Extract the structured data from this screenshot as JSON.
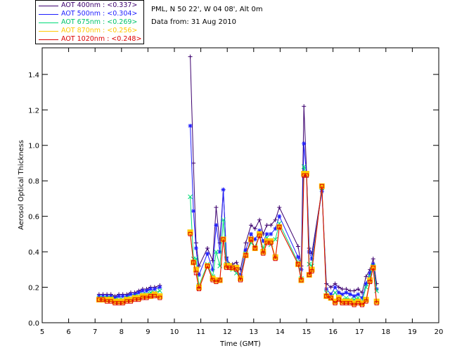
{
  "info": {
    "location": "PML, N 50 22', W 04 08', Alt 0m",
    "date_line": "Data from: 31 Aug 2010"
  },
  "chart_data": {
    "type": "line",
    "xlabel": "Time (GMT)",
    "ylabel": "Aerosol Optical Thickness",
    "xlim": [
      5,
      20
    ],
    "ylim": [
      0,
      1.55
    ],
    "x_ticks": [
      "5",
      "6",
      "7",
      "8",
      "9",
      "10",
      "11",
      "12",
      "13",
      "14",
      "15",
      "16",
      "17",
      "18",
      "19",
      "20"
    ],
    "y_ticks": [
      "0.0",
      "0.2",
      "0.4",
      "0.6",
      "0.8",
      "1.0",
      "1.2",
      "1.4"
    ],
    "legend_placement": "top-left outside plot",
    "series": [
      {
        "name": "AOT  400nm : <0.337>",
        "color": "#3c006e",
        "marker": "plus",
        "x": [
          7.15,
          7.3,
          7.45,
          7.6,
          7.75,
          7.9,
          8.05,
          8.2,
          8.35,
          8.5,
          8.65,
          8.8,
          8.95,
          9.1,
          9.25,
          9.45,
          10.6,
          10.72,
          10.82,
          10.93,
          11.25,
          11.45,
          11.58,
          11.72,
          11.85,
          11.97,
          12.08,
          12.2,
          12.35,
          12.5,
          12.7,
          12.9,
          13.05,
          13.22,
          13.36,
          13.5,
          13.65,
          13.82,
          13.97,
          14.68,
          14.8,
          14.9,
          15.0,
          15.1,
          15.2,
          15.58,
          15.75,
          15.92,
          16.08,
          16.22,
          16.35,
          16.5,
          16.65,
          16.8,
          16.95,
          17.1,
          17.25,
          17.4,
          17.52,
          17.65
        ],
        "y": [
          0.16,
          0.16,
          0.16,
          0.16,
          0.15,
          0.16,
          0.16,
          0.16,
          0.17,
          0.17,
          0.18,
          0.19,
          0.19,
          0.2,
          0.2,
          0.21,
          1.5,
          0.9,
          0.45,
          0.32,
          0.42,
          0.35,
          0.65,
          0.45,
          0.75,
          0.37,
          0.33,
          0.33,
          0.34,
          0.3,
          0.45,
          0.55,
          0.53,
          0.58,
          0.5,
          0.55,
          0.55,
          0.58,
          0.65,
          0.43,
          0.32,
          1.22,
          0.85,
          0.42,
          0.39,
          0.75,
          0.22,
          0.2,
          0.22,
          0.2,
          0.19,
          0.19,
          0.18,
          0.18,
          0.19,
          0.17,
          0.26,
          0.3,
          0.36,
          0.22
        ]
      },
      {
        "name": "AOT  500nm : <0.304>",
        "color": "#1e1eff",
        "marker": "star",
        "x": [
          7.15,
          7.3,
          7.45,
          7.6,
          7.75,
          7.9,
          8.05,
          8.2,
          8.35,
          8.5,
          8.65,
          8.8,
          8.95,
          9.1,
          9.25,
          9.45,
          10.6,
          10.72,
          10.82,
          10.93,
          11.25,
          11.45,
          11.58,
          11.72,
          11.85,
          11.97,
          12.08,
          12.2,
          12.35,
          12.5,
          12.7,
          12.9,
          13.05,
          13.22,
          13.36,
          13.5,
          13.65,
          13.82,
          13.97,
          14.68,
          14.8,
          14.9,
          15.0,
          15.1,
          15.2,
          15.58,
          15.75,
          15.92,
          16.08,
          16.22,
          16.35,
          16.5,
          16.65,
          16.8,
          16.95,
          17.1,
          17.25,
          17.4,
          17.52,
          17.65
        ],
        "y": [
          0.15,
          0.15,
          0.15,
          0.15,
          0.14,
          0.15,
          0.15,
          0.15,
          0.16,
          0.16,
          0.17,
          0.18,
          0.18,
          0.19,
          0.19,
          0.2,
          1.11,
          0.63,
          0.42,
          0.27,
          0.39,
          0.3,
          0.55,
          0.4,
          0.75,
          0.36,
          0.31,
          0.31,
          0.3,
          0.27,
          0.41,
          0.5,
          0.47,
          0.52,
          0.46,
          0.5,
          0.5,
          0.53,
          0.6,
          0.37,
          0.3,
          1.01,
          0.83,
          0.4,
          0.36,
          0.74,
          0.19,
          0.16,
          0.2,
          0.17,
          0.16,
          0.17,
          0.16,
          0.15,
          0.16,
          0.14,
          0.22,
          0.28,
          0.33,
          0.19
        ]
      },
      {
        "name": "AOT  675nm : <0.269>",
        "color": "#00dc78",
        "marker": "x",
        "x": [
          7.15,
          7.3,
          7.45,
          7.6,
          7.75,
          7.9,
          8.05,
          8.2,
          8.35,
          8.5,
          8.65,
          8.8,
          8.95,
          9.1,
          9.25,
          9.45,
          10.6,
          10.72,
          10.82,
          10.93,
          11.25,
          11.45,
          11.58,
          11.72,
          11.85,
          11.97,
          12.08,
          12.2,
          12.35,
          12.5,
          12.7,
          12.9,
          13.05,
          13.22,
          13.36,
          13.5,
          13.65,
          13.82,
          13.97,
          14.68,
          14.8,
          14.9,
          15.0,
          15.1,
          15.2,
          15.58,
          15.75,
          15.92,
          16.08,
          16.22,
          16.35,
          16.5,
          16.65,
          16.8,
          16.95,
          17.1,
          17.25,
          17.4,
          17.52,
          17.65
        ],
        "y": [
          0.14,
          0.14,
          0.14,
          0.14,
          0.13,
          0.13,
          0.13,
          0.14,
          0.14,
          0.15,
          0.15,
          0.16,
          0.16,
          0.17,
          0.17,
          0.18,
          0.71,
          0.36,
          0.36,
          0.21,
          0.33,
          0.26,
          0.4,
          0.32,
          0.58,
          0.33,
          0.31,
          0.3,
          0.28,
          0.25,
          0.39,
          0.45,
          0.43,
          0.49,
          0.42,
          0.48,
          0.44,
          0.47,
          0.56,
          0.34,
          0.25,
          0.88,
          0.83,
          0.33,
          0.32,
          0.76,
          0.17,
          0.14,
          0.17,
          0.14,
          0.13,
          0.14,
          0.13,
          0.13,
          0.14,
          0.12,
          0.2,
          0.26,
          0.32,
          0.18
        ]
      },
      {
        "name": "AOT  870nm : <0.256>",
        "color": "#ffc800",
        "marker": "square",
        "x": [
          7.15,
          7.3,
          7.45,
          7.6,
          7.75,
          7.9,
          8.05,
          8.2,
          8.35,
          8.5,
          8.65,
          8.8,
          8.95,
          9.1,
          9.25,
          9.45,
          10.6,
          10.72,
          10.82,
          10.93,
          11.25,
          11.45,
          11.58,
          11.72,
          11.85,
          11.97,
          12.08,
          12.2,
          12.35,
          12.5,
          12.7,
          12.9,
          13.05,
          13.22,
          13.36,
          13.5,
          13.65,
          13.82,
          13.97,
          14.68,
          14.8,
          14.9,
          15.0,
          15.1,
          15.2,
          15.58,
          15.75,
          15.92,
          16.08,
          16.22,
          16.35,
          16.5,
          16.65,
          16.8,
          16.95,
          17.1,
          17.25,
          17.4,
          17.52,
          17.65
        ],
        "y": [
          0.13,
          0.13,
          0.13,
          0.13,
          0.12,
          0.12,
          0.12,
          0.13,
          0.13,
          0.14,
          0.14,
          0.15,
          0.15,
          0.15,
          0.16,
          0.15,
          0.51,
          0.34,
          0.3,
          0.2,
          0.32,
          0.25,
          0.24,
          0.24,
          0.47,
          0.32,
          0.32,
          0.31,
          0.31,
          0.25,
          0.38,
          0.47,
          0.42,
          0.5,
          0.4,
          0.46,
          0.46,
          0.37,
          0.54,
          0.33,
          0.24,
          0.84,
          0.84,
          0.27,
          0.3,
          0.77,
          0.15,
          0.14,
          0.12,
          0.14,
          0.12,
          0.12,
          0.12,
          0.11,
          0.12,
          0.11,
          0.13,
          0.24,
          0.31,
          0.12
        ]
      },
      {
        "name": "AOT 1020nm : <0.248>",
        "color": "#dc0000",
        "marker": "square",
        "x": [
          7.15,
          7.3,
          7.45,
          7.6,
          7.75,
          7.9,
          8.05,
          8.2,
          8.35,
          8.5,
          8.65,
          8.8,
          8.95,
          9.1,
          9.25,
          9.45,
          10.6,
          10.72,
          10.82,
          10.93,
          11.25,
          11.45,
          11.58,
          11.72,
          11.85,
          11.97,
          12.08,
          12.2,
          12.35,
          12.5,
          12.7,
          12.9,
          13.05,
          13.22,
          13.36,
          13.5,
          13.65,
          13.82,
          13.97,
          14.68,
          14.8,
          14.9,
          15.0,
          15.1,
          15.2,
          15.58,
          15.75,
          15.92,
          16.08,
          16.22,
          16.35,
          16.5,
          16.65,
          16.8,
          16.95,
          17.1,
          17.25,
          17.4,
          17.52,
          17.65
        ],
        "y": [
          0.13,
          0.13,
          0.12,
          0.12,
          0.11,
          0.11,
          0.11,
          0.12,
          0.12,
          0.13,
          0.13,
          0.14,
          0.14,
          0.15,
          0.15,
          0.14,
          0.5,
          0.34,
          0.28,
          0.19,
          0.32,
          0.24,
          0.23,
          0.24,
          0.47,
          0.31,
          0.31,
          0.31,
          0.3,
          0.24,
          0.38,
          0.47,
          0.42,
          0.49,
          0.39,
          0.45,
          0.45,
          0.36,
          0.54,
          0.33,
          0.24,
          0.83,
          0.83,
          0.27,
          0.29,
          0.77,
          0.15,
          0.14,
          0.11,
          0.13,
          0.11,
          0.11,
          0.11,
          0.1,
          0.11,
          0.1,
          0.12,
          0.23,
          0.31,
          0.11
        ]
      }
    ]
  }
}
